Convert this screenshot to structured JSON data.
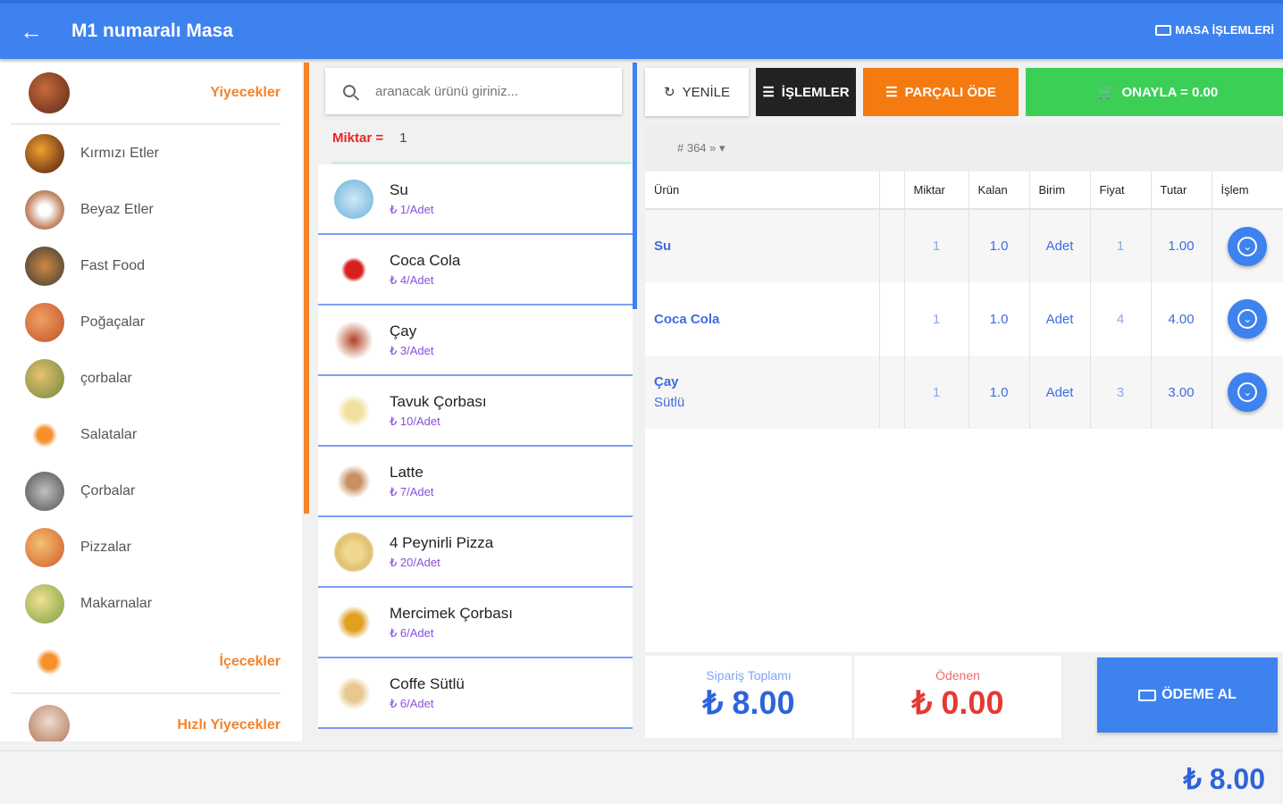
{
  "header": {
    "title": "M1 numaralı Masa",
    "masa_islemleri": "MASA İŞLEMLERİ"
  },
  "categories": {
    "head": "Yiyecekler",
    "items": [
      "Kırmızı Etler",
      "Beyaz Etler",
      "Fast Food",
      "Poğaçalar",
      "çorbalar",
      "Salatalar",
      "Çorbalar",
      "Pizzalar",
      "Makarnalar"
    ],
    "head2": "İçecekler",
    "head3": "Hızlı Yiyecekler"
  },
  "search": {
    "placeholder": "aranacak ürünü giriniz..."
  },
  "quantity": {
    "label": "Miktar =",
    "value": "1"
  },
  "products": [
    {
      "name": "Su",
      "price": "1/Adet"
    },
    {
      "name": "Coca Cola",
      "price": "4/Adet"
    },
    {
      "name": "Çay",
      "price": "3/Adet"
    },
    {
      "name": "Tavuk Çorbası",
      "price": "10/Adet"
    },
    {
      "name": "Latte",
      "price": "7/Adet"
    },
    {
      "name": "4 Peynirli Pizza",
      "price": "20/Adet"
    },
    {
      "name": "Mercimek Çorbası",
      "price": "6/Adet"
    },
    {
      "name": "Coffe Sütlü",
      "price": "6/Adet"
    }
  ],
  "currency_symbol": "₺",
  "toolbar": {
    "yenile": "YENİLE",
    "islemler": "İŞLEMLER",
    "parcali": "PARÇALI ÖDE",
    "onayla": "ONAYLA = 0.00"
  },
  "order_no": "# 364 »",
  "table": {
    "headers": [
      "Ürün",
      "",
      "Miktar",
      "Kalan",
      "Birim",
      "Fiyat",
      "Tutar",
      "İşlem"
    ],
    "rows": [
      {
        "urun": "Su",
        "note": "",
        "miktar": "1",
        "kalan": "1.0",
        "birim": "Adet",
        "fiyat": "1",
        "tutar": "1.00"
      },
      {
        "urun": "Coca Cola",
        "note": "",
        "miktar": "1",
        "kalan": "1.0",
        "birim": "Adet",
        "fiyat": "4",
        "tutar": "4.00"
      },
      {
        "urun": "Çay",
        "note": "Sütlü",
        "miktar": "1",
        "kalan": "1.0",
        "birim": "Adet",
        "fiyat": "3",
        "tutar": "3.00"
      }
    ]
  },
  "summary": {
    "siparis_label": "Sipariş Toplamı",
    "siparis_amount": "₺ 8.00",
    "odenen_label": "Ödenen",
    "odenen_amount": "₺ 0.00",
    "odeme_al": "ÖDEME AL"
  },
  "bottom_total": "₺ 8.00",
  "colors": {
    "primary": "#3d82ef",
    "orange": "#f57a10",
    "green": "#3ccf56",
    "red": "#e33b32",
    "dark": "#222222"
  }
}
